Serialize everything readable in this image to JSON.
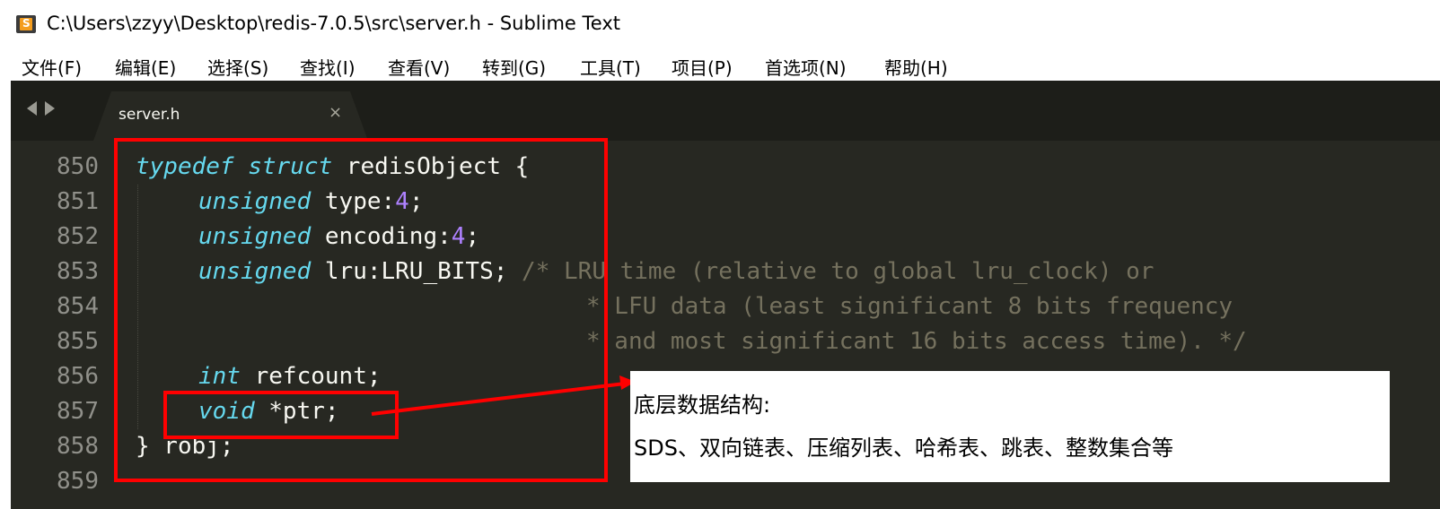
{
  "window": {
    "title": "C:\\Users\\zzyy\\Desktop\\redis-7.0.5\\src\\server.h - Sublime Text",
    "app_icon": "sublime-text-icon"
  },
  "menu": [
    "文件(F)",
    "编辑(E)",
    "选择(S)",
    "查找(I)",
    "查看(V)",
    "转到(G)",
    "工具(T)",
    "项目(P)",
    "首选项(N)",
    "帮助(H)"
  ],
  "tabbar": {
    "nav_left_icon": "triangle-left-icon",
    "nav_right_icon": "triangle-right-icon",
    "tab_label": "server.h",
    "tab_close": "×"
  },
  "editor": {
    "theme_colors": {
      "background": "#272822",
      "keyword": "#66d9ef",
      "number": "#ae81ff",
      "comment": "#75715e",
      "text": "#f8f8f2",
      "line_number": "#90908a"
    },
    "line_numbers": [
      "850",
      "851",
      "852",
      "853",
      "854",
      "855",
      "856",
      "857",
      "858",
      "859"
    ],
    "code": {
      "l850": {
        "kw1": "typedef",
        "kw2": "struct",
        "rest": " redisObject {"
      },
      "l851": {
        "kw": "unsigned",
        "text": " type:",
        "num": "4",
        "end": ";"
      },
      "l852": {
        "kw": "unsigned",
        "text": " encoding:",
        "num": "4",
        "end": ";"
      },
      "l853": {
        "kw": "unsigned",
        "text": " lru:LRU_BITS; ",
        "comment": "/* LRU time (relative to global lru_clock) or"
      },
      "l854": {
        "comment": "* LFU data (least significant 8 bits frequency"
      },
      "l855": {
        "comment": "* and most significant 16 bits access time). */"
      },
      "l856": {
        "kw": "int",
        "text": " refcount;"
      },
      "l857": {
        "kw": "void",
        "text": " *ptr;"
      },
      "l858": {
        "text": "} robj;"
      }
    }
  },
  "annotation": {
    "highlight_color": "#ff0000",
    "callout_title": "底层数据结构:",
    "callout_body": "SDS、双向链表、压缩列表、哈希表、跳表、整数集合等"
  }
}
